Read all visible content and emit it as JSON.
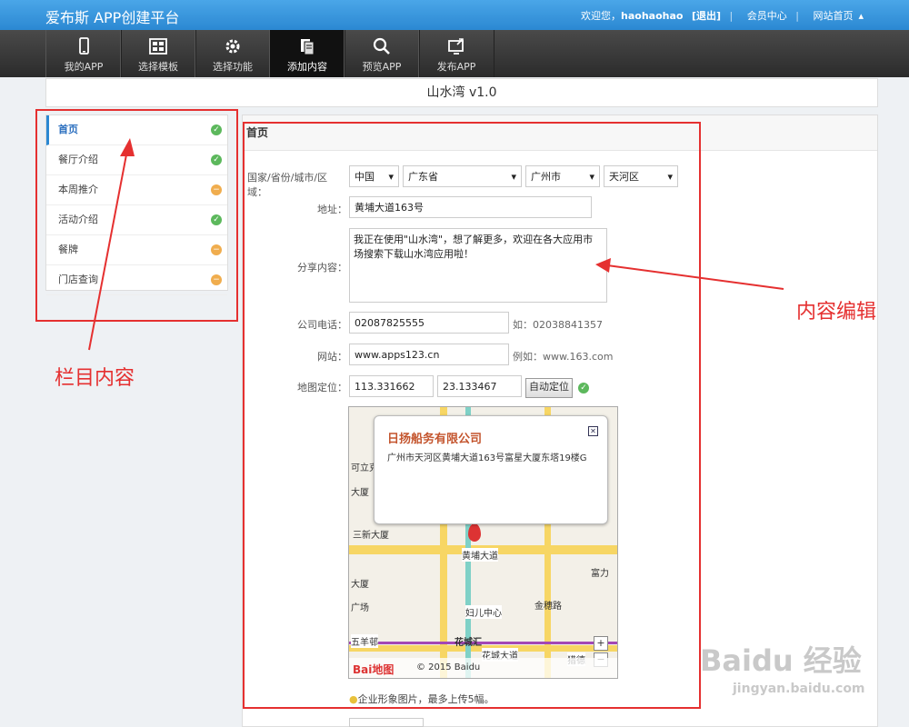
{
  "header": {
    "brand": "爱布斯 APP创建平台",
    "welcome": "欢迎您，",
    "username": "haohaohao",
    "logout": "[退出]",
    "member_center": "会员中心",
    "site_home": "网站首页"
  },
  "nav": [
    {
      "label": "我的APP",
      "icon": "phone-icon"
    },
    {
      "label": "选择模板",
      "icon": "template-icon"
    },
    {
      "label": "选择功能",
      "icon": "gear-icon"
    },
    {
      "label": "添加内容",
      "icon": "document-icon"
    },
    {
      "label": "预览APP",
      "icon": "search-icon"
    },
    {
      "label": "发布APP",
      "icon": "publish-icon"
    }
  ],
  "app_title": "山水湾 v1.0",
  "sidebar": {
    "items": [
      {
        "label": "首页",
        "status": "ok"
      },
      {
        "label": "餐厅介绍",
        "status": "ok"
      },
      {
        "label": "本周推介",
        "status": "warn"
      },
      {
        "label": "活动介绍",
        "status": "ok"
      },
      {
        "label": "餐牌",
        "status": "warn"
      },
      {
        "label": "门店查询",
        "status": "warn"
      }
    ]
  },
  "form": {
    "section_title": "首页",
    "region_label": "国家/省份/城市/区域：",
    "country": "中国",
    "province": "广东省",
    "city": "广州市",
    "district": "天河区",
    "address_label": "地址：",
    "address_value": "黄埔大道163号",
    "share_label": "分享内容：",
    "share_value": "我正在使用\"山水湾\"，想了解更多，欢迎在各大应用市场搜索下载山水湾应用啦！",
    "phone_label": "公司电话：",
    "phone_value": "02087825555",
    "phone_hint": "如：02038841357",
    "website_label": "网站：",
    "website_value": "www.apps123.cn",
    "website_hint": "例如：www.163.com",
    "map_label": "地图定位：",
    "lng_value": "113.331662",
    "lat_value": "23.133467",
    "auto_locate": "自动定位",
    "image_hint": "企业形象图片，最多上传5幅。"
  },
  "map": {
    "popup_title": "日扬船务有限公司",
    "popup_address": "广州市天河区黄埔大道163号富星大厦东塔19楼G",
    "labels": [
      "黄埔大道",
      "妇儿中心",
      "花城汇",
      "花城大道",
      "五羊邨",
      "猎德",
      "金穗路",
      "三新大厦",
      "富力",
      "可立克",
      "大厦",
      "广场",
      "大厦"
    ],
    "copyright": "© 2015 Baidu",
    "logo": "Bai地图"
  },
  "annotations": {
    "left": "栏目内容",
    "right": "内容编辑"
  },
  "watermark": "Baidu 经验",
  "watermark_url": "jingyan.baidu.com",
  "colors": {
    "accent": "#2b88d2",
    "annotation": "#e53030",
    "ok": "#5cb85c",
    "warn": "#f0ad4e"
  }
}
